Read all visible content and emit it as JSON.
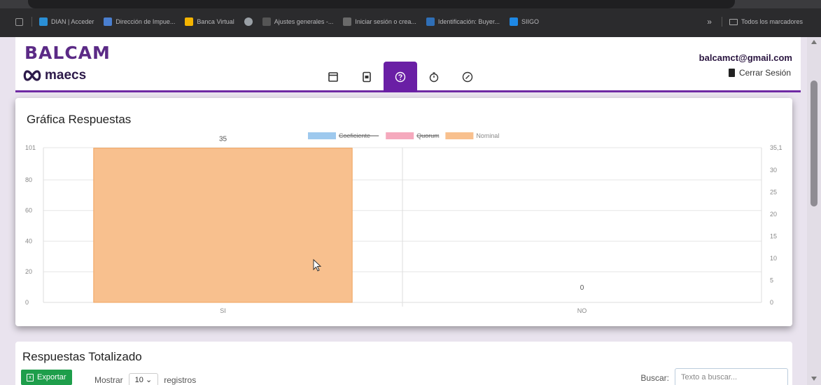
{
  "browser": {
    "bookmarks": [
      {
        "label": "DIAN | Acceder",
        "icon": "dian-icon",
        "color": "#2a8fd6"
      },
      {
        "label": "Dirección de Impue...",
        "icon": "dian-arrow-icon",
        "color": "#4a7fd0"
      },
      {
        "label": "Banca Virtual",
        "icon": "bank-icon",
        "color": "#f4b400"
      },
      {
        "label": "",
        "icon": "globe-icon",
        "color": "#9aa0a6"
      },
      {
        "label": "Ajustes generales -...",
        "icon": "settings-icon",
        "color": "#555555"
      },
      {
        "label": "Iniciar sesión o crea...",
        "icon": "login-icon",
        "color": "#6a6a6a"
      },
      {
        "label": "Identificación: Buyer...",
        "icon": "buyer-icon",
        "color": "#2f6fb7"
      },
      {
        "label": "SIIGO",
        "icon": "siigo-icon",
        "color": "#1e88e5"
      }
    ],
    "overflow": "»",
    "all_bookmarks": "Todos los marcadores"
  },
  "header": {
    "brand_top": "BALCAM",
    "brand_bottom": "maecs",
    "user_email": "balcamct@gmail.com",
    "logout": "Cerrar Sesión",
    "nav": [
      {
        "icon": "calendar-icon",
        "active": false
      },
      {
        "icon": "ballot-box-icon",
        "active": false
      },
      {
        "icon": "question-icon",
        "active": true
      },
      {
        "icon": "timer-icon",
        "active": false
      },
      {
        "icon": "check-circle-icon",
        "active": false
      }
    ],
    "accent_color": "#6a1fa5"
  },
  "chart_card": {
    "title": "Gráfica Respuestas"
  },
  "chart_data": {
    "type": "bar",
    "categories": [
      "SI",
      "NO"
    ],
    "series": [
      {
        "name": "Coeficiente",
        "values": [
          null,
          null
        ],
        "color": "#9ec9ee",
        "hidden": true
      },
      {
        "name": "Quorum",
        "values": [
          null,
          null
        ],
        "color": "#f5a9bd",
        "hidden": true
      },
      {
        "name": "Nominal",
        "values": [
          35,
          0
        ],
        "color": "#f8c08e",
        "hidden": false
      }
    ],
    "data_labels": [
      "35",
      "0"
    ],
    "y_left": {
      "ticks": [
        "0",
        "20",
        "40",
        "60",
        "80",
        "101"
      ],
      "range": [
        0,
        101
      ]
    },
    "y_right": {
      "ticks": [
        "0",
        "5",
        "10",
        "15",
        "20",
        "25",
        "30",
        "35,1"
      ],
      "range": [
        0,
        35.1
      ]
    },
    "legend_position": "top-center",
    "grid": true
  },
  "table_card": {
    "title": "Respuestas Totalizado",
    "export_label": "Exportar",
    "show_label": "Mostrar",
    "page_size": "10",
    "records_label": "registros",
    "search_label": "Buscar:",
    "search_placeholder": "Texto a buscar..."
  }
}
